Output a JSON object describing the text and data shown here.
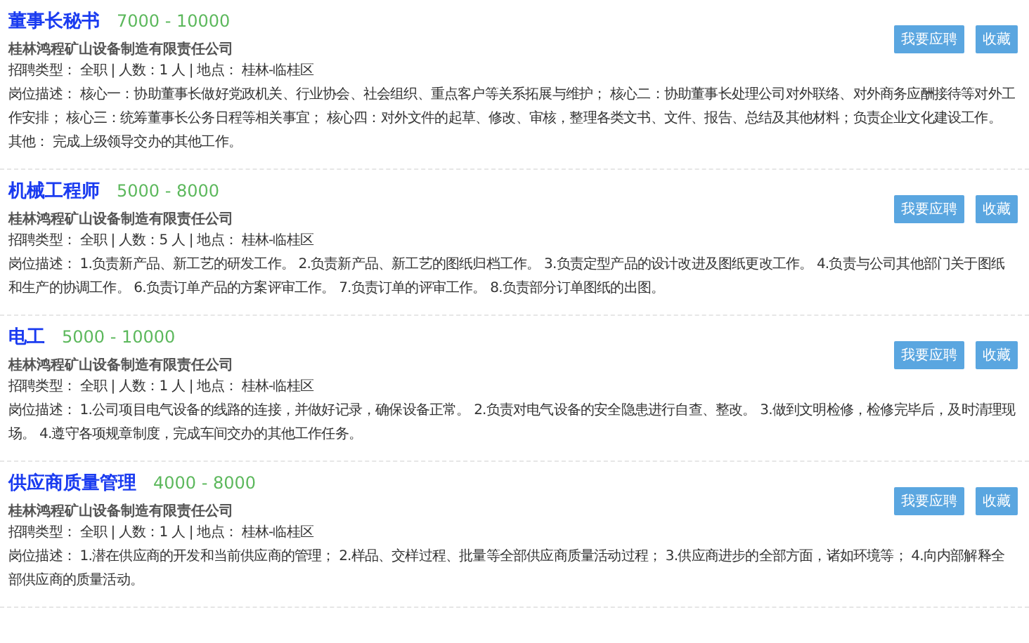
{
  "jobs": [
    {
      "title": "董事长秘书",
      "salary": "7000 - 10000",
      "company": "桂林鸿程矿山设备制造有限责任公司",
      "meta": "招聘类型： 全职 | 人数：1 人 | 地点： 桂林-临桂区",
      "description": "岗位描述： 核心一：协助董事长做好党政机关、行业协会、社会组织、重点客户等关系拓展与维护； 核心二：协助董事长处理公司对外联络、对外商务应酬接待等对外工作安排； 核心三：统筹董事长公务日程等相关事宜； 核心四：对外文件的起草、修改、审核，整理各类文书、文件、报告、总结及其他材料；负责企业文化建设工作。",
      "other": "其他： 完成上级领导交办的其他工作。",
      "buttons": [
        "我要应聘",
        "收藏"
      ]
    },
    {
      "title": "机械工程师",
      "salary": "5000 - 8000",
      "company": "桂林鸿程矿山设备制造有限责任公司",
      "meta": "招聘类型： 全职 | 人数：5 人 | 地点： 桂林-临桂区",
      "description": "岗位描述： 1.负责新产品、新工艺的研发工作。 2.负责新产品、新工艺的图纸归档工作。 3.负责定型产品的设计改进及图纸更改工作。 4.负责与公司其他部门关于图纸和生产的协调工作。 6.负责订单产品的方案评审工作。 7.负责订单的评审工作。 8.负责部分订单图纸的出图。",
      "buttons": [
        "我要应聘",
        "收藏"
      ]
    },
    {
      "title": "电工",
      "salary": "5000 - 10000",
      "company": "桂林鸿程矿山设备制造有限责任公司",
      "meta": "招聘类型： 全职 | 人数：1 人 | 地点： 桂林-临桂区",
      "description": "岗位描述： 1.公司项目电气设备的线路的连接，并做好记录，确保设备正常。 2.负责对电气设备的安全隐患进行自查、整改。 3.做到文明检修，检修完毕后，及时清理现场。 4.遵守各项规章制度，完成车间交办的其他工作任务。",
      "buttons": [
        "我要应聘",
        "收藏"
      ]
    },
    {
      "title": "供应商质量管理",
      "salary": "4000 - 8000",
      "company": "桂林鸿程矿山设备制造有限责任公司",
      "meta": "招聘类型： 全职 | 人数：1 人 | 地点： 桂林-临桂区",
      "description": "岗位描述： 1.潜在供应商的开发和当前供应商的管理； 2.样品、交样过程、批量等全部供应商质量活动过程； 3.供应商进步的全部方面，诸如环境等； 4.向内部解释全部供应商的质量活动。",
      "buttons": [
        "我要应聘",
        "收藏"
      ]
    }
  ]
}
